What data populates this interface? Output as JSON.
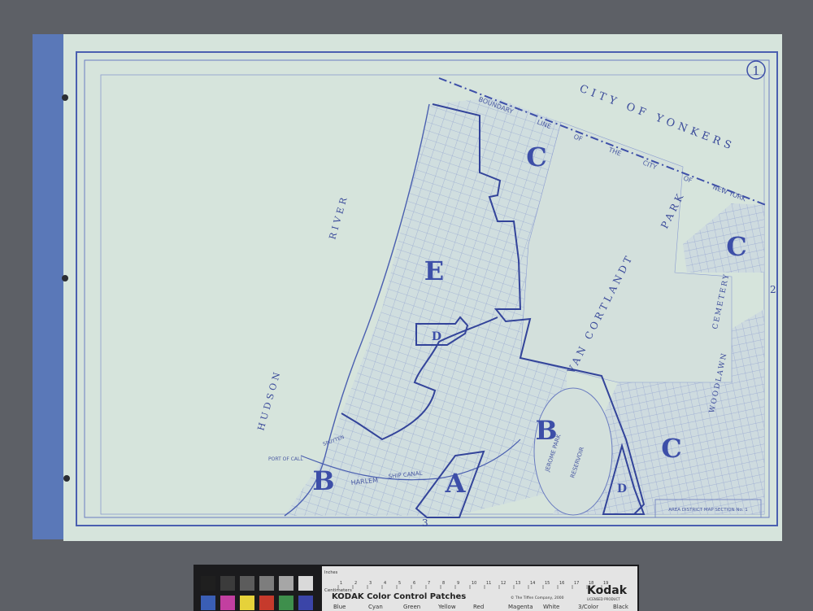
{
  "map": {
    "sheet_number": "1",
    "edge_number_right": "2",
    "edge_number_bottom": "3",
    "labels": {
      "hudson": "HUDSON",
      "river": "RIVER",
      "boundary": "BOUNDARY",
      "line": "LINE",
      "of1": "OF",
      "the": "THE",
      "city": "CITY",
      "of2": "OF",
      "new_york": "NEW YORK",
      "city_of_yonkers": "CITY OF YONKERS",
      "van_cortlandt": "VAN CORTLANDT",
      "park": "PARK",
      "cemetery": "CEMETERY",
      "woodlawn": "WOODLAWN",
      "jerome_park": "JEROME PARK",
      "reservoir": "RESERVOIR",
      "harlem": "HARLEM",
      "ship_canal": "SHIP CANAL",
      "spuyten": "SPUYTEN",
      "port_of_call": "PORT OF CALL",
      "title_block": "AREA DISTRICT MAP SECTION No. 1"
    },
    "zones": {
      "c_top": "C",
      "c_right": "C",
      "c_lower": "C",
      "e": "E",
      "d_small": "D",
      "d_right": "D",
      "b_center": "B",
      "b_left": "B",
      "a": "A"
    }
  },
  "color_patch_card": {
    "title": "KODAK Color Control Patches",
    "copyright": "© The Tiffen Company, 2000",
    "brand": "Kodak",
    "brand_sub": "LICENSED PRODUCT",
    "inches_label": "Inches",
    "cm_label": "Centimeters",
    "ruler_numbers": [
      "1",
      "2",
      "3",
      "4",
      "5",
      "6",
      "7",
      "8",
      "9",
      "10",
      "11",
      "12",
      "13",
      "14",
      "15",
      "16",
      "17",
      "18",
      "19"
    ],
    "swatch_names": [
      "Blue",
      "Cyan",
      "Green",
      "Yellow",
      "Red",
      "Magenta",
      "White",
      "3/Color",
      "Black"
    ],
    "colors": {
      "gray_patches": [
        "#1f1f1f",
        "#3b3b3b",
        "#5c5c5c",
        "#7d7d7d",
        "#a6a6a6",
        "#d9d9d9"
      ],
      "color_patches": [
        "#3a5eb5",
        "#c23fa0",
        "#e6d23a",
        "#c63a2c",
        "#3e8f4c",
        "#3b45a8"
      ]
    }
  }
}
